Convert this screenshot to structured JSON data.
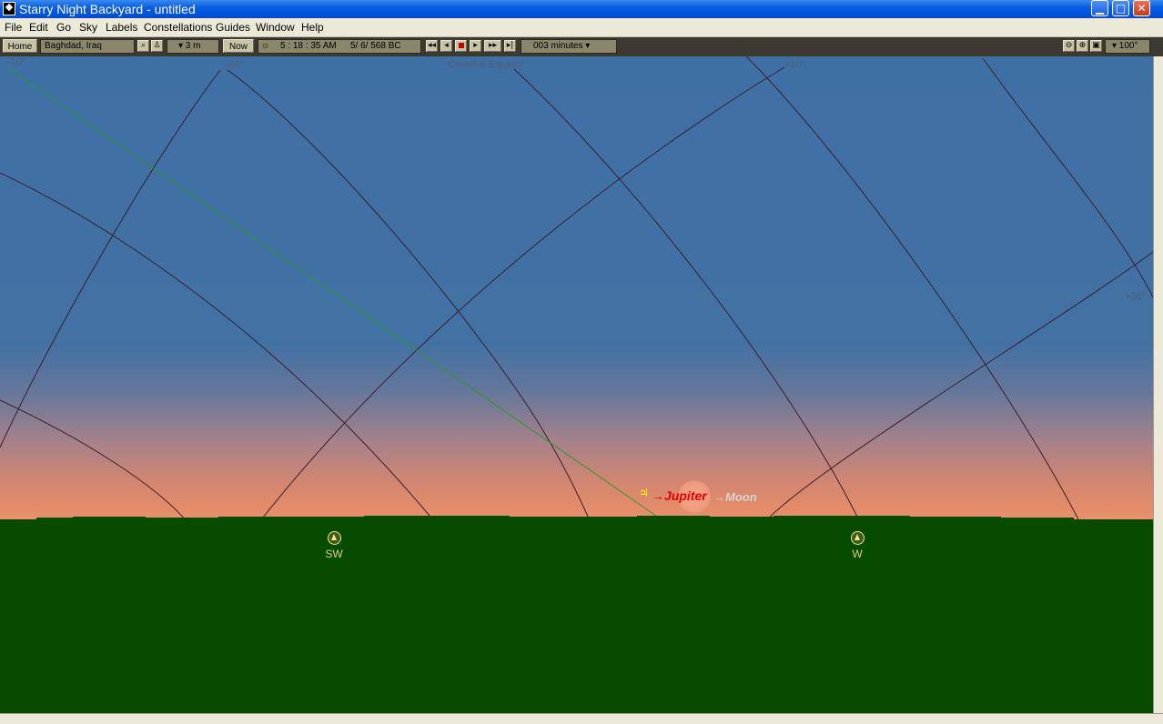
{
  "window": {
    "title": "Starry Night Backyard - untitled",
    "controls": {
      "minimize": "▁",
      "maximize": "□",
      "close": "✕"
    }
  },
  "menu": [
    "File",
    "Edit",
    "Go",
    "Sky",
    "Labels",
    "Constellations",
    "Guides",
    "Window",
    "Help"
  ],
  "toolbar": {
    "home_label": "Home",
    "location": "Baghdad, Iraq",
    "elevation": "▾ 3 m",
    "now_label": "Now",
    "time": "5 : 18 : 35 AM",
    "date": "5/   6/   568 BC",
    "time_step": "003 minutes ▾",
    "fov": "▾ 100°",
    "playback_icons": [
      "rewind-icon",
      "step-back-icon",
      "stop-icon",
      "play-icon",
      "fast-forward-icon",
      "end-icon"
    ],
    "zoom_icons": [
      "zoom-out-icon",
      "zoom-in-icon",
      "zoom-box-icon"
    ]
  },
  "sky": {
    "grid_labels": [
      "-10°",
      "-20°",
      "Celestial Equator",
      "+10°",
      "+20°"
    ],
    "objects": [
      {
        "name": "Jupiter",
        "symbol": "♃",
        "color": "#e60000"
      },
      {
        "name": "Moon",
        "color": "#d4d4d4"
      }
    ],
    "compass": [
      {
        "label": "SW"
      },
      {
        "label": "W"
      }
    ],
    "colors": {
      "sky_top": "#3f70a5",
      "horizon_glow": "#ec9572",
      "ground": "#074b00",
      "grid_line": "#3a1e2c",
      "ecliptic": "#2a9a2a"
    }
  }
}
